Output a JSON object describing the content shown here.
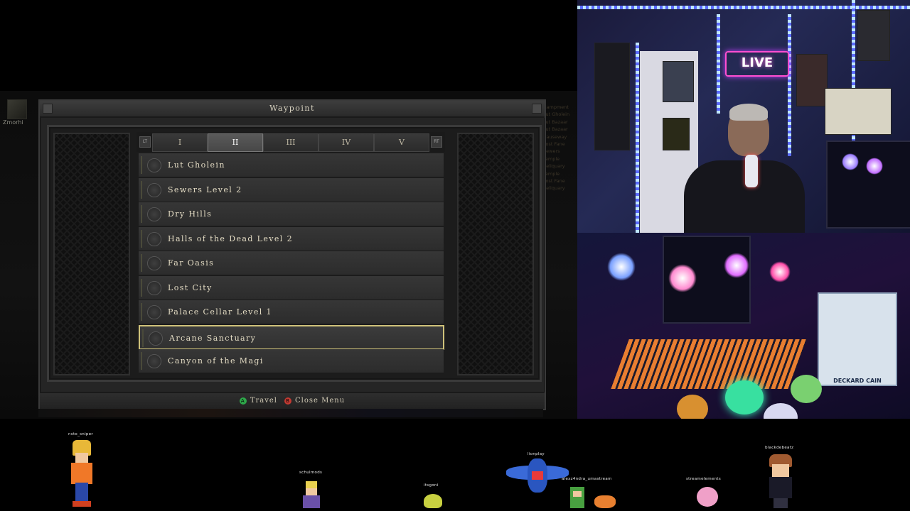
{
  "game": {
    "player_name": "Zmorhi",
    "side_list": [
      "Campment",
      "Lut Gholein",
      "Lut Bazaar",
      "Lut Bazaar",
      "Causeway",
      "Lost Fane",
      "Sewers",
      "Temple",
      "Reliquary",
      "Temple",
      "Lost Fane",
      "Reliquary"
    ],
    "waypoint_panel": {
      "title": "Waypoint",
      "left_bumper": "LT",
      "right_bumper": "RT",
      "tabs": [
        {
          "label": "I",
          "active": false
        },
        {
          "label": "II",
          "active": true
        },
        {
          "label": "III",
          "active": false
        },
        {
          "label": "IV",
          "active": false
        },
        {
          "label": "V",
          "active": false
        }
      ],
      "waypoints": [
        {
          "label": "Lut Gholein",
          "selected": false
        },
        {
          "label": "Sewers Level 2",
          "selected": false
        },
        {
          "label": "Dry Hills",
          "selected": false
        },
        {
          "label": "Halls of the Dead Level 2",
          "selected": false
        },
        {
          "label": "Far Oasis",
          "selected": false
        },
        {
          "label": "Lost City",
          "selected": false
        },
        {
          "label": "Palace Cellar Level 1",
          "selected": false
        },
        {
          "label": "Arcane Sanctuary",
          "selected": true
        },
        {
          "label": "Canyon of the Magi",
          "selected": false
        }
      ],
      "footer": {
        "a_glyph": "A",
        "travel_label": "Travel",
        "b_glyph": "B",
        "close_label": "Close Menu"
      }
    }
  },
  "webcam": {
    "live_sign": "LIVE",
    "funko_label": "DECKARD CAIN"
  },
  "stream_overlay": {
    "avatars": [
      {
        "name": "nsto_sniper"
      },
      {
        "name": "schulmods"
      },
      {
        "name": "itsgoni"
      },
      {
        "name": "lionplay"
      },
      {
        "name": "alexz4ndra_umastream"
      },
      {
        "name": "streamelements"
      },
      {
        "name": "blackdebeatz"
      }
    ]
  },
  "colors": {
    "selection_border": "#cfc27a",
    "travel_button": "#2ea84a",
    "close_button": "#c23a32",
    "waypoint_text": "#e4dcc4"
  }
}
